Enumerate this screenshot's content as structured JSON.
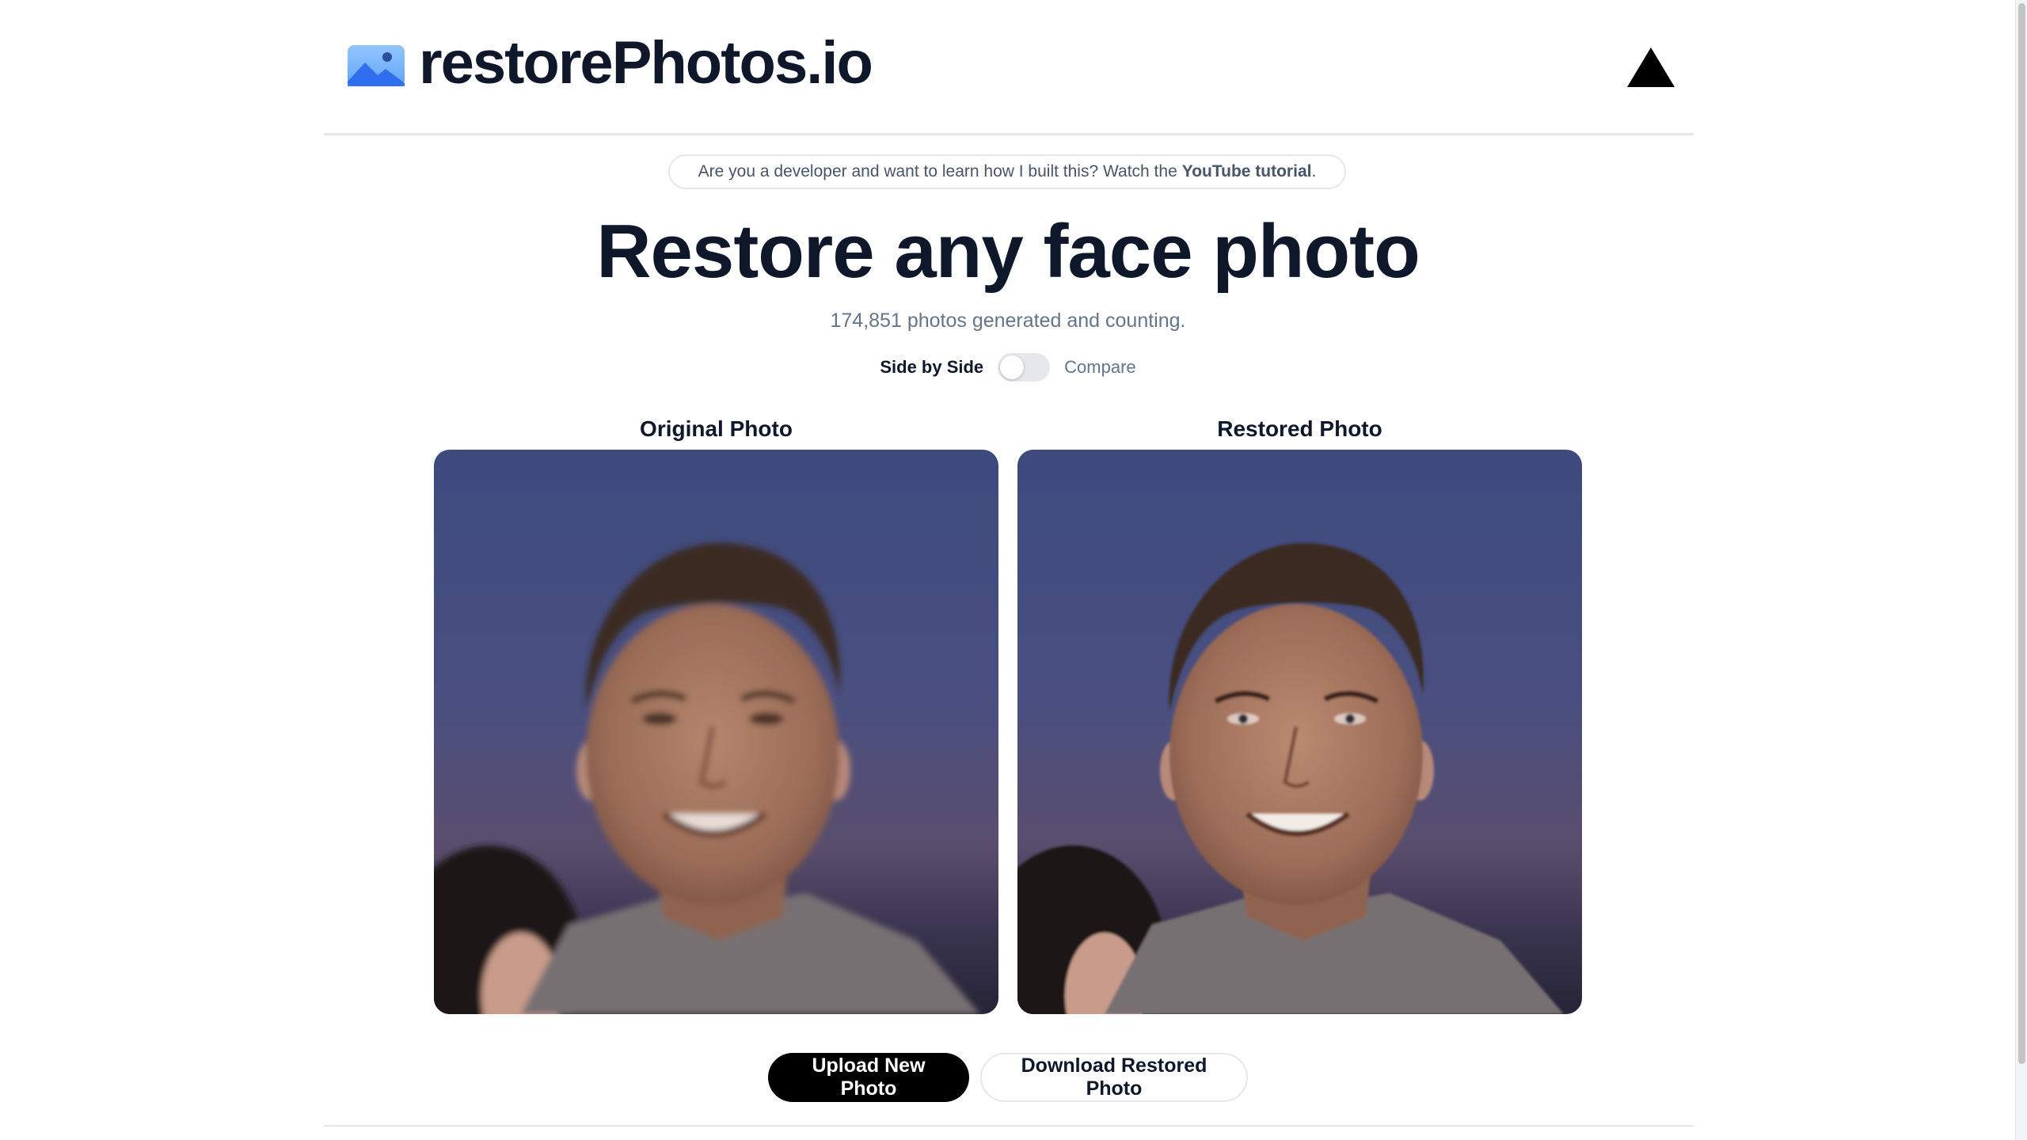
{
  "header": {
    "brand": "restorePhotos.io",
    "brand_icon": "photo-icon",
    "right_icon": "vercel-triangle-icon"
  },
  "banner": {
    "text": "Are you a developer and want to learn how I built this? Watch the",
    "link_label": "YouTube tutorial",
    "suffix": "."
  },
  "hero": {
    "title": "Restore any face photo",
    "counter": "174,851 photos generated and counting."
  },
  "toggle": {
    "left_label": "Side by Side",
    "right_label": "Compare",
    "state": "Side by Side"
  },
  "photos": {
    "original_label": "Original Photo",
    "restored_label": "Restored Photo"
  },
  "actions": {
    "upload_label": "Upload New Photo",
    "download_label": "Download Restored Photo"
  },
  "colors": {
    "text_dark": "#0f172a",
    "text_muted": "#64748b",
    "border": "#e5e7eb",
    "primary_button": "#000000",
    "logo_blue": "#60a5fa"
  }
}
